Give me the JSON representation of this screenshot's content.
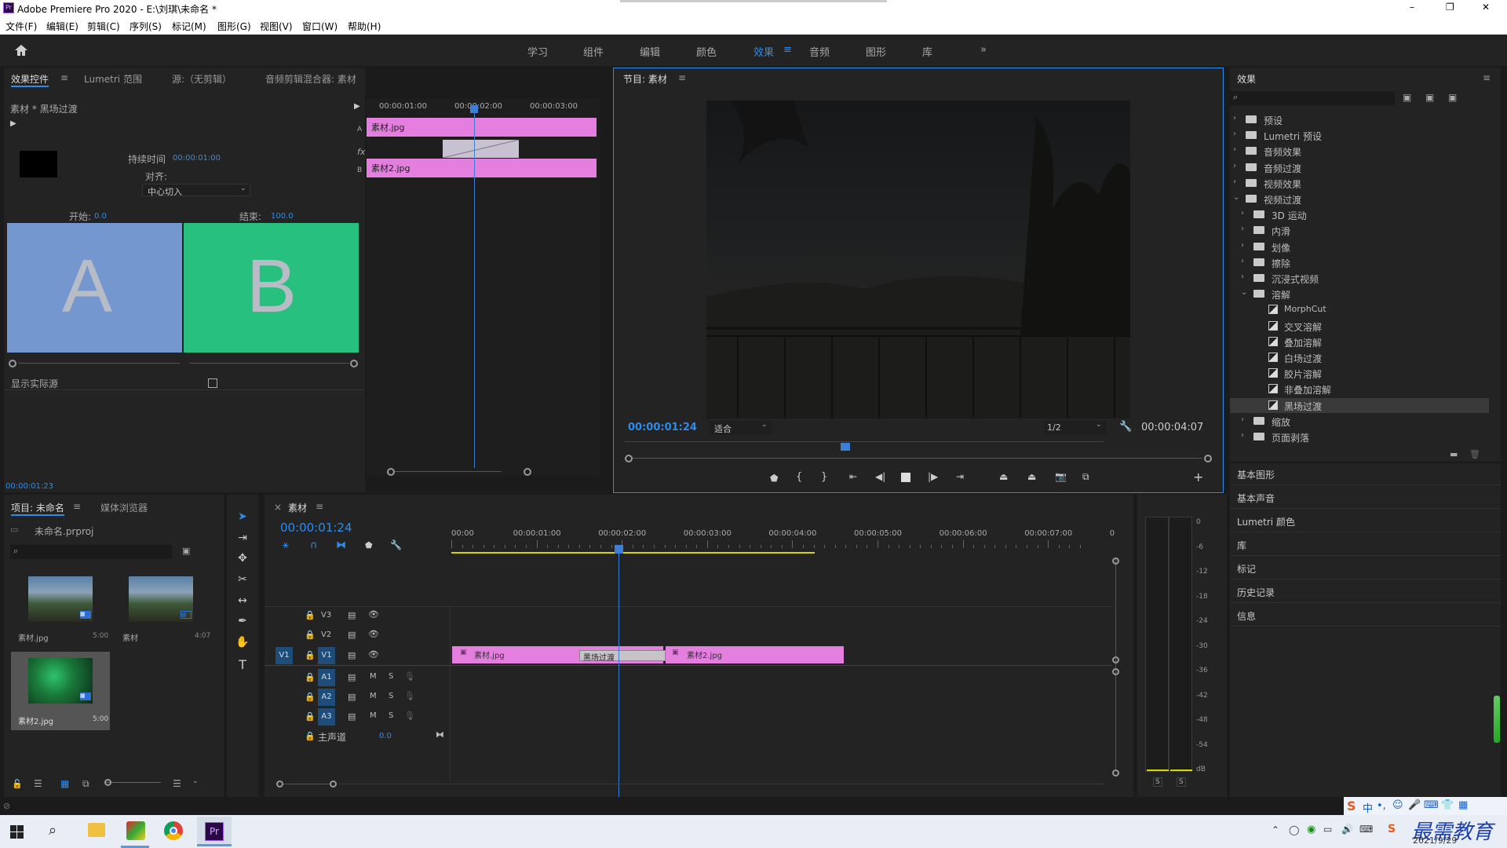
{
  "titlebar": {
    "app": "Adobe Premiere Pro 2020 - E:\\刘琪\\未命名 *",
    "min": "–",
    "max": "❐",
    "close": "✕"
  },
  "menu": [
    "文件(F)",
    "编辑(E)",
    "剪辑(C)",
    "序列(S)",
    "标记(M)",
    "图形(G)",
    "视图(V)",
    "窗口(W)",
    "帮助(H)"
  ],
  "workspaces": [
    "学习",
    "组件",
    "编辑",
    "颜色",
    "效果",
    "音频",
    "图形",
    "库"
  ],
  "workspace_active": "效果",
  "workspace_more": "»",
  "effect_controls": {
    "tabs": [
      "效果控件",
      "Lumetri 范围",
      "源:（无剪辑）",
      "音频剪辑混合器: 素材"
    ],
    "menu_icon": "≡",
    "clip_title": "素材 * 黑场过渡",
    "duration_label": "持续时间",
    "duration_value": "00:00:01:00",
    "align_label": "对齐:",
    "align_value": "中心切入",
    "start_label": "开始:",
    "start_value": "0.0",
    "end_label": "结束:",
    "end_value": "100.0",
    "a_letter": "A",
    "b_letter": "B",
    "show_actual": "显示实际源",
    "timecode": "00:00:01:23",
    "mini_ruler": [
      "00:00:01:00",
      "00:00:02:00",
      "00:00:03:00"
    ],
    "mini_a": "A",
    "mini_b": "B",
    "mini_fx": "fx",
    "clip_a": "素材.jpg",
    "clip_b": "素材2.jpg"
  },
  "program": {
    "title": "节目: 素材",
    "timecode": "00:00:01:24",
    "fit": "适合",
    "quality": "1/2",
    "duration": "00:00:04:07",
    "playhead_fraction": 0.45
  },
  "effects": {
    "title": "效果",
    "items": [
      {
        "label": "预设",
        "level": 0,
        "open": false
      },
      {
        "label": "Lumetri 预设",
        "level": 0,
        "open": false
      },
      {
        "label": "音频效果",
        "level": 0,
        "open": false
      },
      {
        "label": "音频过渡",
        "level": 0,
        "open": false
      },
      {
        "label": "视频效果",
        "level": 0,
        "open": false
      },
      {
        "label": "视频过渡",
        "level": 0,
        "open": true
      },
      {
        "label": "3D 运动",
        "level": 1,
        "open": false
      },
      {
        "label": "内滑",
        "level": 1,
        "open": false
      },
      {
        "label": "划像",
        "level": 1,
        "open": false
      },
      {
        "label": "擦除",
        "level": 1,
        "open": false
      },
      {
        "label": "沉浸式视频",
        "level": 1,
        "open": false
      },
      {
        "label": "溶解",
        "level": 1,
        "open": true
      },
      {
        "label": "MorphCut",
        "level": 2
      },
      {
        "label": "交叉溶解",
        "level": 2
      },
      {
        "label": "叠加溶解",
        "level": 2
      },
      {
        "label": "白场过渡",
        "level": 2
      },
      {
        "label": "胶片溶解",
        "level": 2
      },
      {
        "label": "非叠加溶解",
        "level": 2
      },
      {
        "label": "黑场过渡",
        "level": 2,
        "selected": true
      },
      {
        "label": "缩放",
        "level": 1,
        "open": false
      },
      {
        "label": "页面剥落",
        "level": 1,
        "open": false
      }
    ],
    "side_panels": [
      "基本图形",
      "基本声音",
      "Lumetri 颜色",
      "库",
      "标记",
      "历史记录",
      "信息"
    ]
  },
  "project": {
    "tabs": [
      "项目: 未命名",
      "媒体浏览器"
    ],
    "file": "未命名.prproj",
    "items": [
      {
        "name": "素材.jpg",
        "dur": "5:00"
      },
      {
        "name": "素材",
        "dur": "4:07"
      },
      {
        "name": "素材2.jpg",
        "dur": "5:00"
      }
    ]
  },
  "timeline": {
    "tab": "素材",
    "close": "×",
    "timecode": "00:00:01:24",
    "ruler": [
      "00:00",
      "00:00:01:00",
      "00:00:02:00",
      "00:00:03:00",
      "00:00:04:00",
      "00:00:05:00",
      "00:00:06:00",
      "00:00:07:00",
      "0"
    ],
    "tracks_v": [
      "V3",
      "V2",
      "V1"
    ],
    "tracks_a": [
      "A1",
      "A2",
      "A3"
    ],
    "v1_src": "V1",
    "master": "主声道",
    "master_val": "0.0",
    "m": "M",
    "s": "S",
    "clip1": "素材.jpg",
    "transition": "黑场过渡",
    "clip2": "素材2.jpg"
  },
  "meter": {
    "scale": [
      "0",
      "-6",
      "-12",
      "-18",
      "-24",
      "-30",
      "-36",
      "-42",
      "-48",
      "-54",
      "dB"
    ],
    "s1": "S",
    "s2": "S"
  },
  "taskbar": {
    "date": "2021/9/29",
    "watermark": "最需教育",
    "ime": "中"
  }
}
